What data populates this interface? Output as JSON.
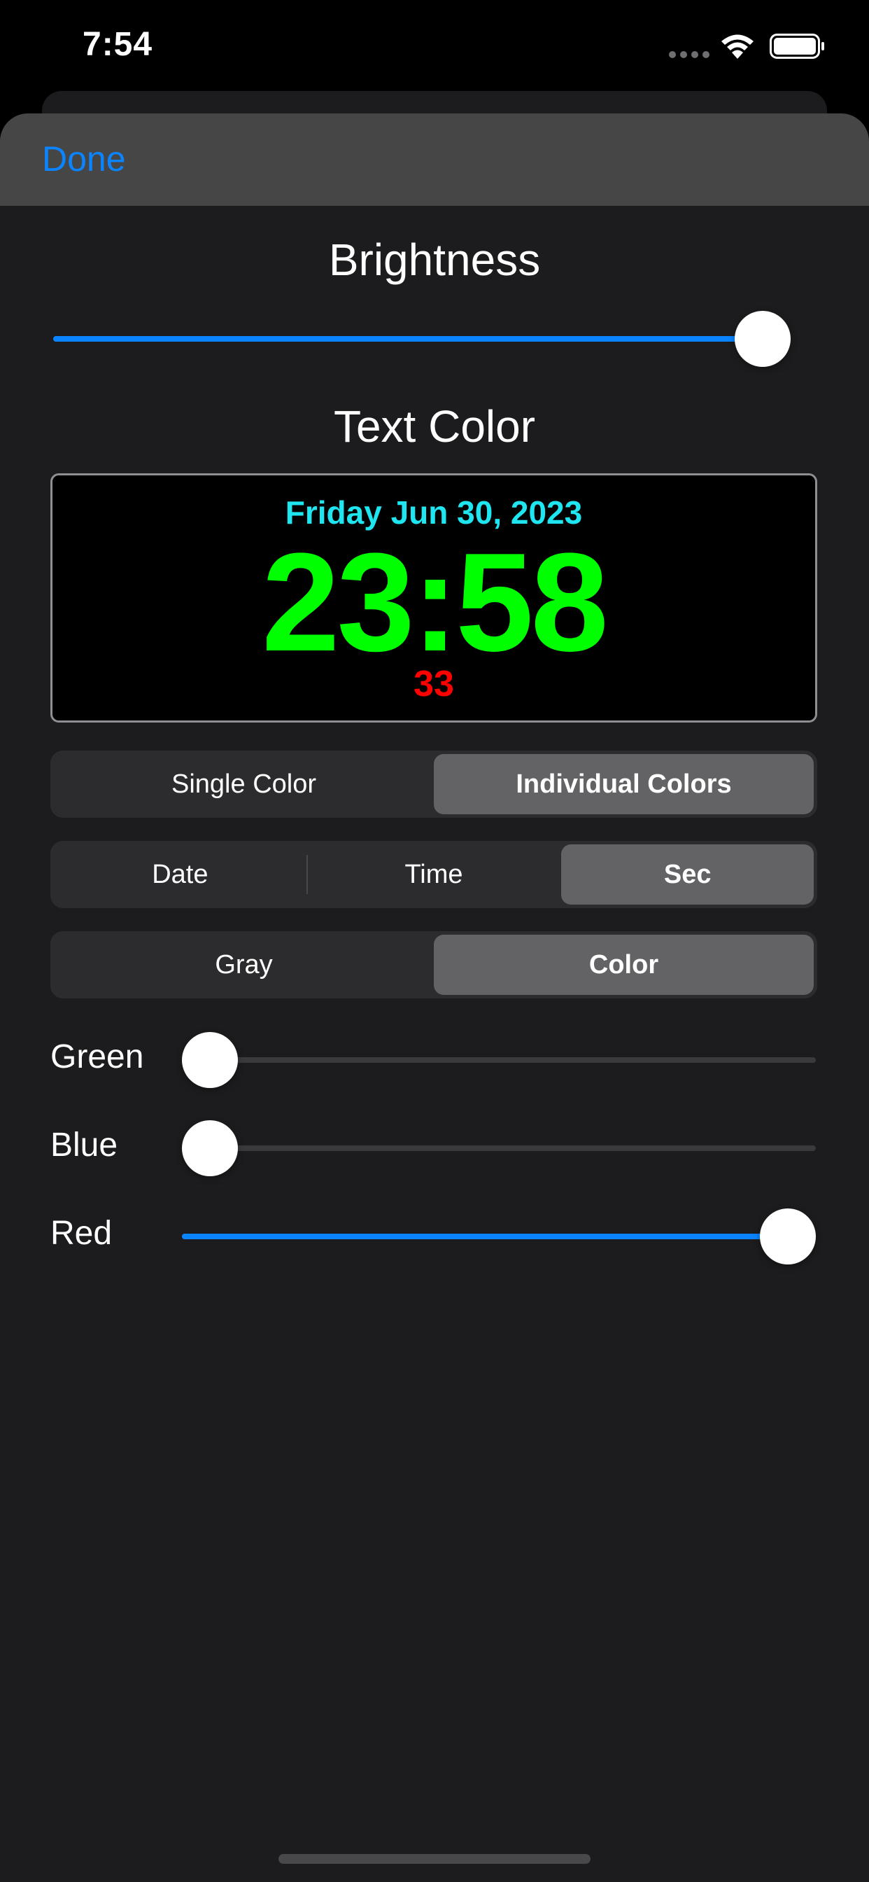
{
  "status_bar": {
    "time": "7:54",
    "icons": [
      "signal-dots-icon",
      "wifi-icon",
      "battery-icon"
    ]
  },
  "header": {
    "done_label": "Done"
  },
  "brightness": {
    "title": "Brightness",
    "value": 1.0
  },
  "text_color": {
    "title": "Text Color"
  },
  "preview": {
    "date": "Friday Jun 30, 2023",
    "time": "23:58",
    "seconds": "33",
    "date_color": "#1ee5f0",
    "time_color": "#00ff00",
    "seconds_color": "#ff0000"
  },
  "mode_segment": {
    "options": [
      "Single Color",
      "Individual Colors"
    ],
    "selected": "Individual Colors"
  },
  "part_segment": {
    "options": [
      "Date",
      "Time",
      "Sec"
    ],
    "selected": "Sec"
  },
  "tone_segment": {
    "options": [
      "Gray",
      "Color"
    ],
    "selected": "Color"
  },
  "channels": {
    "green": {
      "label": "Green",
      "value": 0.0
    },
    "blue": {
      "label": "Blue",
      "value": 0.0
    },
    "red": {
      "label": "Red",
      "value": 1.0
    }
  },
  "colors": {
    "accent": "#0a84ff",
    "sheet_background": "#1c1c1e",
    "header_background": "#464646"
  }
}
